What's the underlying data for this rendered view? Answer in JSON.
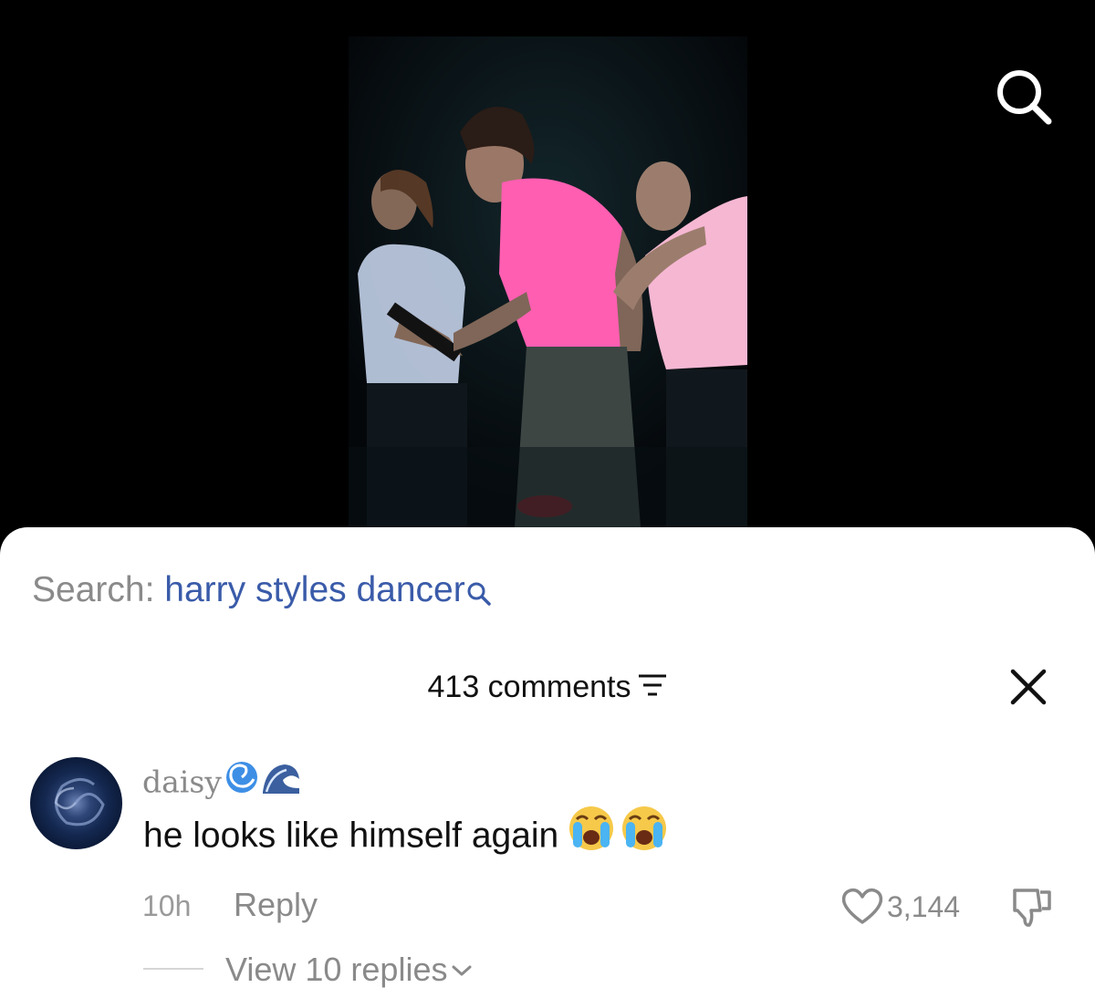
{
  "search": {
    "prefix": "Search: ",
    "query": "harry styles dancer"
  },
  "comments": {
    "header": "413 comments"
  },
  "comment": {
    "username": "daisy",
    "username_emojis": "🌀🌊",
    "text": "he looks like himself again",
    "text_emojis": "😭😭",
    "time": "10h",
    "reply_label": "Reply",
    "like_count": "3,144",
    "view_replies_label": "View 10 replies"
  },
  "icons": {
    "top_search": "search-icon",
    "inline_search": "search-icon",
    "filter": "filter-icon",
    "close": "close-icon",
    "like": "heart-icon",
    "dislike": "thumbs-down-icon",
    "expand": "chevron-down-icon"
  },
  "colors": {
    "search_query": "#3a5ba9",
    "muted_text": "#8a8a8a",
    "primary_text": "#111111",
    "sheet_background": "#ffffff",
    "video_background": "#000000"
  }
}
